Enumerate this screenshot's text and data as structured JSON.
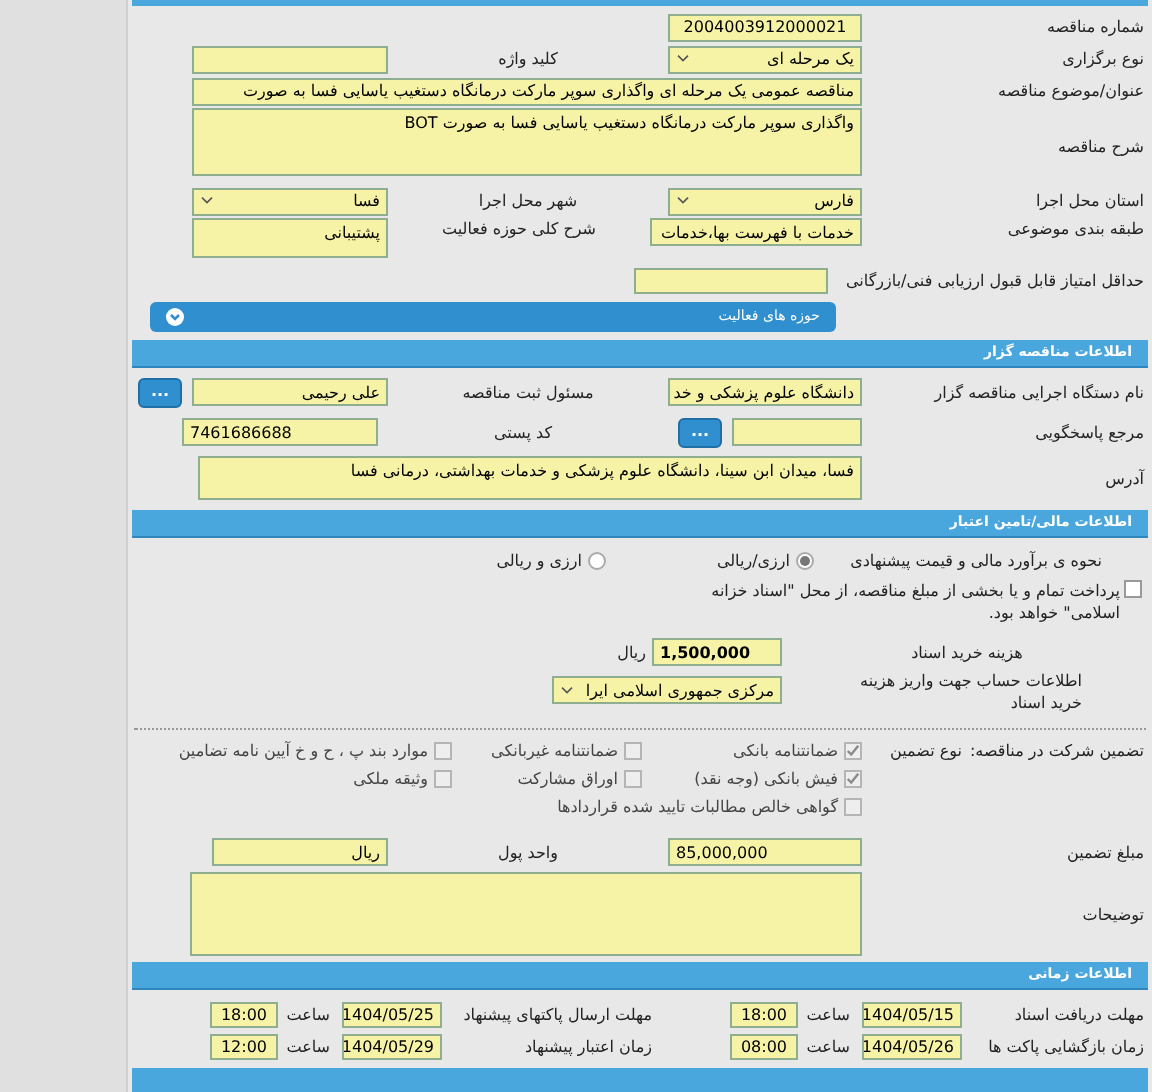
{
  "tender": {
    "number": {
      "label": "شماره مناقصه",
      "value": "2004003912000021"
    },
    "holding_type": {
      "label": "نوع برگزاری",
      "value": "یک مرحله ای"
    },
    "keyword": {
      "label": "کلید واژه"
    },
    "title": {
      "label": "عنوان/موضوع مناقصه",
      "value": "مناقصه عمومی یک مرحله ای واگذاری سوپر مارکت درمانگاه دستغیب یاسایی فسا به صورت"
    },
    "description": {
      "label": "شرح مناقصه",
      "value": "واگذاری سوپر مارکت درمانگاه دستغیب یاسایی فسا به صورت BOT"
    },
    "province": {
      "label": "استان محل اجرا",
      "value": "فارس"
    },
    "city": {
      "label": "شهر محل اجرا",
      "value": "فسا"
    },
    "category": {
      "label": "طبقه بندی موضوعی",
      "value": "خدمات با فهرست بها،خدمات"
    },
    "activity_scope": {
      "label": "شرح کلی حوزه فعالیت",
      "value": "پشتیبانی"
    },
    "min_score": {
      "label": "حداقل امتیاز قابل قبول ارزیابی فنی/بازرگانی"
    },
    "activity_areas": {
      "title": "حوزه های فعالیت"
    }
  },
  "organizer": {
    "title": "اطلاعات مناقصه گزار",
    "agency": {
      "label": "نام دستگاه اجرایی مناقصه گزار",
      "value": "دانشگاه علوم پزشکی و خد"
    },
    "registrar": {
      "label": "مسئول ثبت مناقصه",
      "value": "علی رحیمی",
      "button": "..."
    },
    "contact": {
      "label": "مرجع پاسخگویی",
      "button": "..."
    },
    "postal_code": {
      "label": "کد پستی",
      "value": "7461686688"
    },
    "address": {
      "label": "آدرس",
      "value": "فسا، میدان ابن سینا، دانشگاه علوم پزشکی و خدمات بهداشتی، درمانی فسا"
    }
  },
  "financial": {
    "title": "اطلاعات مالی/تامین اعتبار",
    "estimate_label": "نحوه ی برآورد مالی و قیمت پیشنهادی",
    "estimate_options": [
      {
        "label": "ارزی/ریالی",
        "selected": true
      },
      {
        "label": "ارزی و ریالی",
        "selected": false
      }
    ],
    "treasury": {
      "label": "پرداخت تمام و یا بخشی از مبلغ مناقصه، از محل \"اسناد خزانه اسلامی\" خواهد بود.",
      "checked": false
    },
    "doc_fee": {
      "label": "هزینه خرید اسناد",
      "value": "1,500,000",
      "unit": "ریال"
    },
    "account": {
      "label": "اطلاعات حساب جهت واریز هزینه خرید اسناد",
      "value": "مرکزی جمهوری اسلامی ایرا"
    }
  },
  "guarantee": {
    "label": "تضمین شرکت در مناقصه:",
    "type_label": "نوع تضمین",
    "options": [
      {
        "label": "ضمانتنامه بانکی",
        "checked": true
      },
      {
        "label": "ضمانتنامه غیربانکی",
        "checked": false
      },
      {
        "label": "موارد بند پ ، ح و خ آیین نامه تضامین",
        "checked": false
      },
      {
        "label": "فیش بانکی (وجه نقد)",
        "checked": true
      },
      {
        "label": "اوراق مشارکت",
        "checked": false
      },
      {
        "label": "وثیقه ملکی",
        "checked": false
      },
      {
        "label": "گواهی خالص مطالبات تایید شده قراردادها",
        "checked": false
      }
    ],
    "amount": {
      "label": "مبلغ تضمین",
      "value": "85,000,000"
    },
    "currency": {
      "label": "واحد پول",
      "value": "ریال"
    },
    "notes": {
      "label": "توضیحات"
    }
  },
  "timing": {
    "title": "اطلاعات زمانی",
    "items": [
      {
        "label": "مهلت دریافت اسناد",
        "date": "1404/05/15",
        "time_label": "ساعت",
        "time": "18:00"
      },
      {
        "label": "مهلت ارسال پاکتهای پیشنهاد",
        "date": "1404/05/25",
        "time_label": "ساعت",
        "time": "18:00"
      },
      {
        "label": "زمان بازگشایی پاکت ها",
        "date": "1404/05/26",
        "time_label": "ساعت",
        "time": "08:00"
      },
      {
        "label": "زمان اعتبار پیشنهاد",
        "date": "1404/05/29",
        "time_label": "ساعت",
        "time": "12:00"
      }
    ]
  }
}
